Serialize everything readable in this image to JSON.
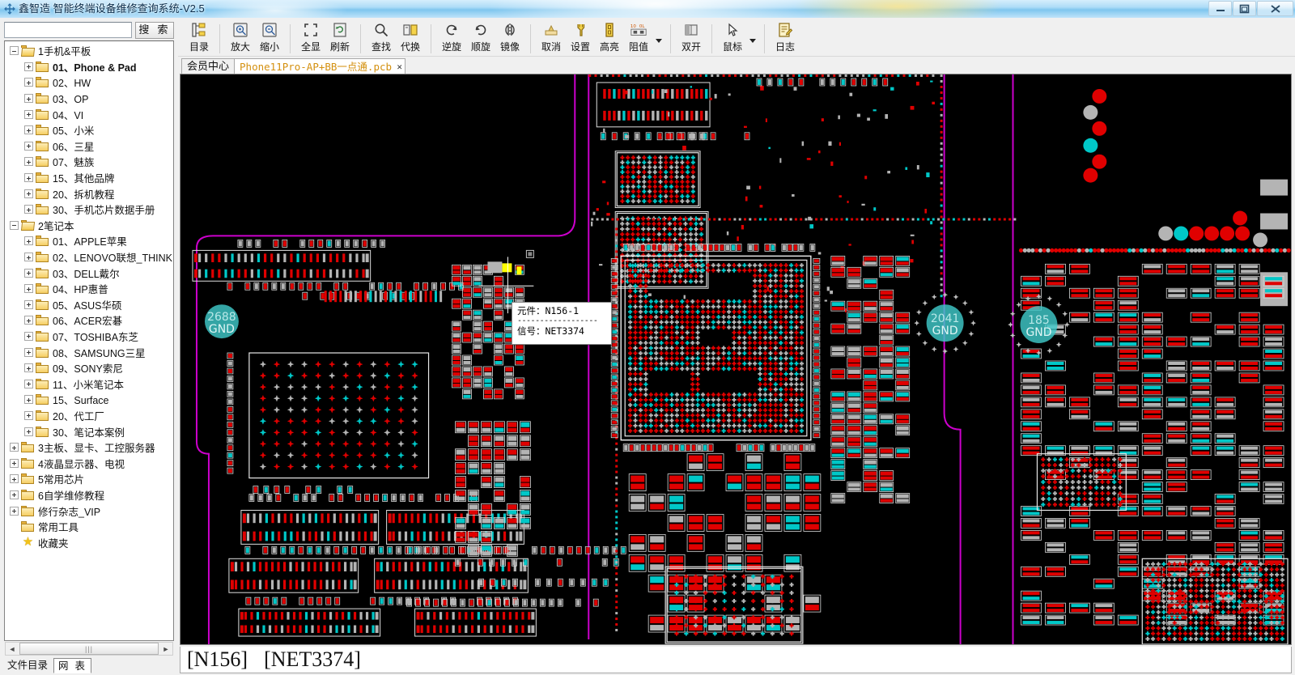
{
  "window": {
    "title": "鑫智造 智能终端设备维修查询系统-V2.5",
    "app_icon": "app-crosshair-icon",
    "minimize": "—",
    "maximize": "❐",
    "close": "✕"
  },
  "search": {
    "value": "",
    "placeholder": "",
    "button_label": "搜 索"
  },
  "tree": {
    "items": [
      {
        "label": "1手机&平板",
        "depth": 0,
        "expander": "minus",
        "icon": "folder-open-icon",
        "bold": false
      },
      {
        "label": "01、Phone & Pad",
        "depth": 1,
        "expander": "plus",
        "icon": "folder-icon",
        "bold": true
      },
      {
        "label": "02、HW",
        "depth": 1,
        "expander": "plus",
        "icon": "folder-icon",
        "bold": false
      },
      {
        "label": "03、OP",
        "depth": 1,
        "expander": "plus",
        "icon": "folder-icon",
        "bold": false
      },
      {
        "label": "04、VI",
        "depth": 1,
        "expander": "plus",
        "icon": "folder-icon",
        "bold": false
      },
      {
        "label": "05、小米",
        "depth": 1,
        "expander": "plus",
        "icon": "folder-icon",
        "bold": false
      },
      {
        "label": "06、三星",
        "depth": 1,
        "expander": "plus",
        "icon": "folder-icon",
        "bold": false
      },
      {
        "label": "07、魅族",
        "depth": 1,
        "expander": "plus",
        "icon": "folder-icon",
        "bold": false
      },
      {
        "label": "15、其他品牌",
        "depth": 1,
        "expander": "plus",
        "icon": "folder-icon",
        "bold": false
      },
      {
        "label": "20、拆机教程",
        "depth": 1,
        "expander": "plus",
        "icon": "folder-icon",
        "bold": false
      },
      {
        "label": "30、手机芯片数据手册",
        "depth": 1,
        "expander": "plus",
        "icon": "folder-icon",
        "bold": false
      },
      {
        "label": "2笔记本",
        "depth": 0,
        "expander": "minus",
        "icon": "folder-open-icon",
        "bold": false
      },
      {
        "label": "01、APPLE苹果",
        "depth": 1,
        "expander": "plus",
        "icon": "folder-icon",
        "bold": false
      },
      {
        "label": "02、LENOVO联想_THINK",
        "depth": 1,
        "expander": "plus",
        "icon": "folder-icon",
        "bold": false
      },
      {
        "label": "03、DELL戴尔",
        "depth": 1,
        "expander": "plus",
        "icon": "folder-icon",
        "bold": false
      },
      {
        "label": "04、HP惠普",
        "depth": 1,
        "expander": "plus",
        "icon": "folder-icon",
        "bold": false
      },
      {
        "label": "05、ASUS华硕",
        "depth": 1,
        "expander": "plus",
        "icon": "folder-icon",
        "bold": false
      },
      {
        "label": "06、ACER宏碁",
        "depth": 1,
        "expander": "plus",
        "icon": "folder-icon",
        "bold": false
      },
      {
        "label": "07、TOSHIBA东芝",
        "depth": 1,
        "expander": "plus",
        "icon": "folder-icon",
        "bold": false
      },
      {
        "label": "08、SAMSUNG三星",
        "depth": 1,
        "expander": "plus",
        "icon": "folder-icon",
        "bold": false
      },
      {
        "label": "09、SONY索尼",
        "depth": 1,
        "expander": "plus",
        "icon": "folder-icon",
        "bold": false
      },
      {
        "label": "11、小米笔记本",
        "depth": 1,
        "expander": "plus",
        "icon": "folder-icon",
        "bold": false
      },
      {
        "label": "15、Surface",
        "depth": 1,
        "expander": "plus",
        "icon": "folder-icon",
        "bold": false
      },
      {
        "label": "20、代工厂",
        "depth": 1,
        "expander": "plus",
        "icon": "folder-icon",
        "bold": false
      },
      {
        "label": "30、笔记本案例",
        "depth": 1,
        "expander": "plus",
        "icon": "folder-icon",
        "bold": false
      },
      {
        "label": "3主板、显卡、工控服务器",
        "depth": 0,
        "expander": "plus",
        "icon": "folder-icon",
        "bold": false
      },
      {
        "label": "4液晶显示器、电视",
        "depth": 0,
        "expander": "plus",
        "icon": "folder-icon",
        "bold": false
      },
      {
        "label": "5常用芯片",
        "depth": 0,
        "expander": "plus",
        "icon": "folder-icon",
        "bold": false
      },
      {
        "label": "6自学维修教程",
        "depth": 0,
        "expander": "plus",
        "icon": "folder-icon",
        "bold": false
      },
      {
        "label": "修行杂志_VIP",
        "depth": 0,
        "expander": "plus",
        "icon": "folder-icon",
        "bold": false
      },
      {
        "label": "常用工具",
        "depth": 0,
        "expander": "none",
        "icon": "folder-icon",
        "bold": false
      },
      {
        "label": "收藏夹",
        "depth": 0,
        "expander": "none",
        "icon": "star-icon",
        "bold": false
      }
    ]
  },
  "hscroll": {
    "left_arrow": "◄",
    "right_arrow": "►",
    "thumb_grip": "|||"
  },
  "bottom_tabs": [
    {
      "label": "文件目录",
      "active": false
    },
    {
      "label": "网 表",
      "active": true
    }
  ],
  "toolbar": {
    "groups": [
      {
        "buttons": [
          {
            "label": "目录",
            "icon": "tree-directory-icon"
          }
        ]
      },
      {
        "buttons": [
          {
            "label": "放大",
            "icon": "zoom-in-icon"
          },
          {
            "label": "缩小",
            "icon": "zoom-out-icon"
          }
        ]
      },
      {
        "buttons": [
          {
            "label": "全显",
            "icon": "fit-to-screen-icon"
          },
          {
            "label": "刷新",
            "icon": "refresh-icon"
          }
        ]
      },
      {
        "buttons": [
          {
            "label": "查找",
            "icon": "search-icon"
          },
          {
            "label": "代换",
            "icon": "replace-icon"
          }
        ]
      },
      {
        "buttons": [
          {
            "label": "逆旋",
            "icon": "rotate-ccw-icon"
          },
          {
            "label": "顺旋",
            "icon": "rotate-cw-icon"
          },
          {
            "label": "镜像",
            "icon": "mirror-icon"
          }
        ]
      },
      {
        "buttons": [
          {
            "label": "取消",
            "icon": "cancel-icon"
          },
          {
            "label": "设置",
            "icon": "settings-wrench-icon"
          },
          {
            "label": "高亮",
            "icon": "highlight-icon"
          },
          {
            "label": "阻值",
            "icon": "resistance-icon"
          }
        ],
        "caret": true
      },
      {
        "buttons": [
          {
            "label": "双开",
            "icon": "dual-pane-icon"
          }
        ]
      },
      {
        "buttons": [
          {
            "label": "鼠标",
            "icon": "mouse-cursor-icon"
          }
        ],
        "caret": true
      },
      {
        "buttons": [
          {
            "label": "日志",
            "icon": "log-icon"
          }
        ]
      }
    ]
  },
  "file_tabs": [
    {
      "label": "会员中心",
      "active": false,
      "closable": false
    },
    {
      "label": "Phone11Pro-AP+BB一点通.pcb",
      "active": true,
      "closable": true,
      "close_glyph": "✕"
    }
  ],
  "tooltip": {
    "component_label": "元件：",
    "component_value": "N156-1",
    "separator": "------------------",
    "signal_label": "信号：",
    "signal_value": "NET3374"
  },
  "status": {
    "component": "[N156]",
    "net": "[NET3374]"
  },
  "canvas": {
    "background": "#000000",
    "outline_color": "#cc00cc",
    "pad_red": "#e00000",
    "pad_gray": "#b4b4b4",
    "pad_cyan": "#00c8c8",
    "highlight_yellow": "#ffff00",
    "gnd_pads": [
      {
        "number": "2688",
        "label": "GND"
      },
      {
        "number": "2041",
        "label": "GND"
      },
      {
        "number": "185",
        "label": "GND"
      }
    ]
  }
}
